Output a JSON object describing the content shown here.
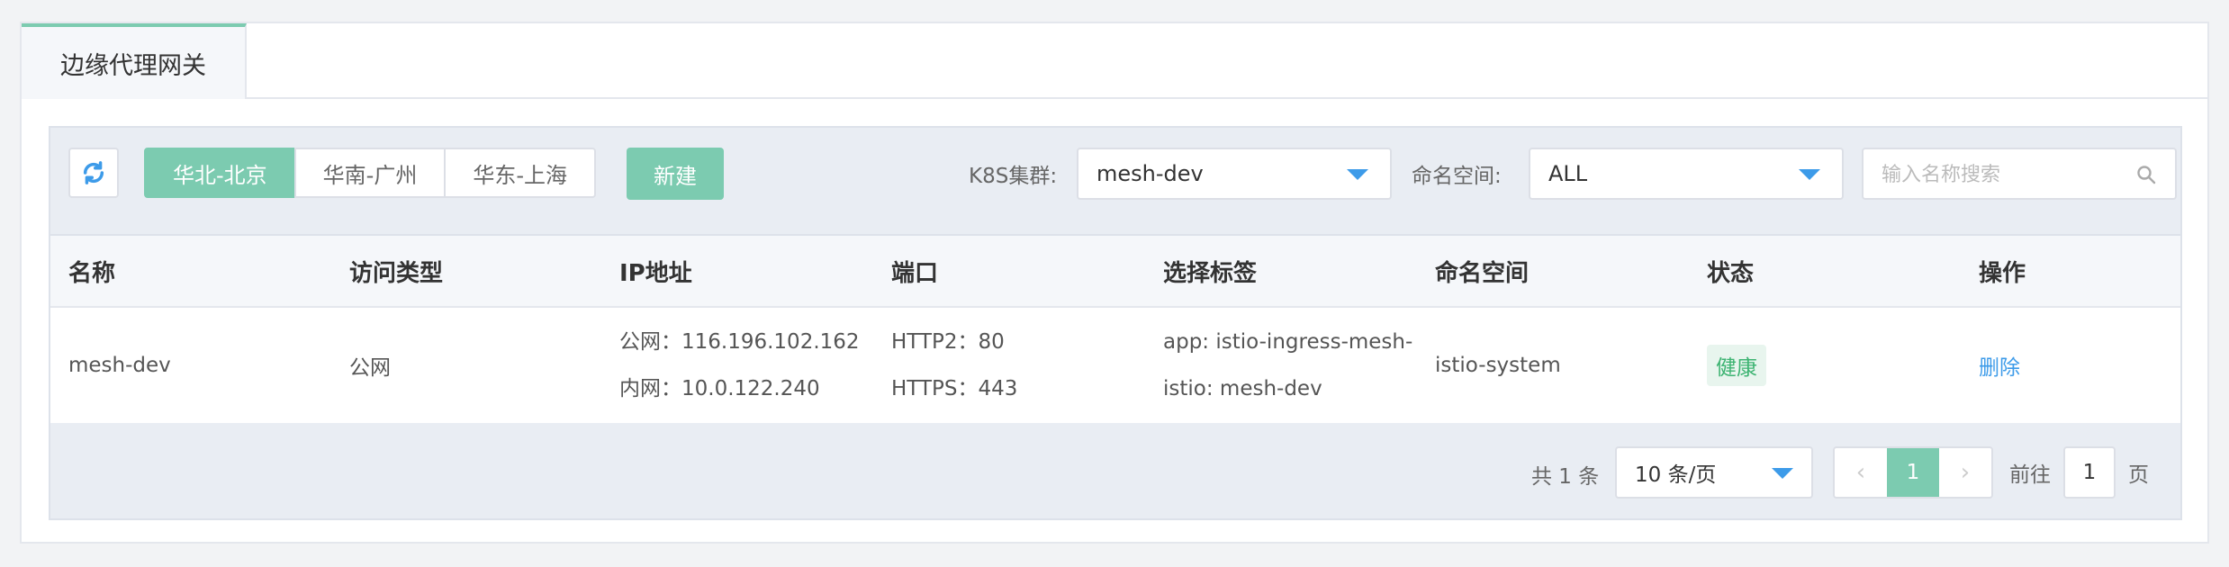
{
  "tabs": [
    {
      "label": "边缘代理网关"
    }
  ],
  "toolbar": {
    "regions": [
      "华北-北京",
      "华南-广州",
      "华东-上海"
    ],
    "new_button": "新建",
    "cluster_label": "K8S集群:",
    "cluster_value": "mesh-dev",
    "namespace_label": "命名空间:",
    "namespace_value": "ALL",
    "search_placeholder": "输入名称搜索"
  },
  "table": {
    "headers": [
      "名称",
      "访问类型",
      "IP地址",
      "端口",
      "选择标签",
      "命名空间",
      "状态",
      "操作"
    ],
    "rows": [
      {
        "name": "mesh-dev",
        "access_type": "公网",
        "ip_public": "公网：116.196.102.162",
        "ip_private": "内网：10.0.122.240",
        "port_http2": "HTTP2：80",
        "port_https": "HTTPS：443",
        "label_app": "app: istio-ingress-mesh-",
        "label_istio": "istio: mesh-dev",
        "namespace": "istio-system",
        "status": "健康",
        "action": "删除"
      }
    ]
  },
  "pagination": {
    "total": "共 1 条",
    "page_size": "10 条/页",
    "prev": "‹",
    "current": "1",
    "next": "›",
    "goto_prefix": "前往",
    "goto_value": "1",
    "goto_suffix": "页"
  },
  "colors": {
    "accent": "#7ccbb0",
    "link": "#3d9be9",
    "status_ok": "#3cb371"
  }
}
